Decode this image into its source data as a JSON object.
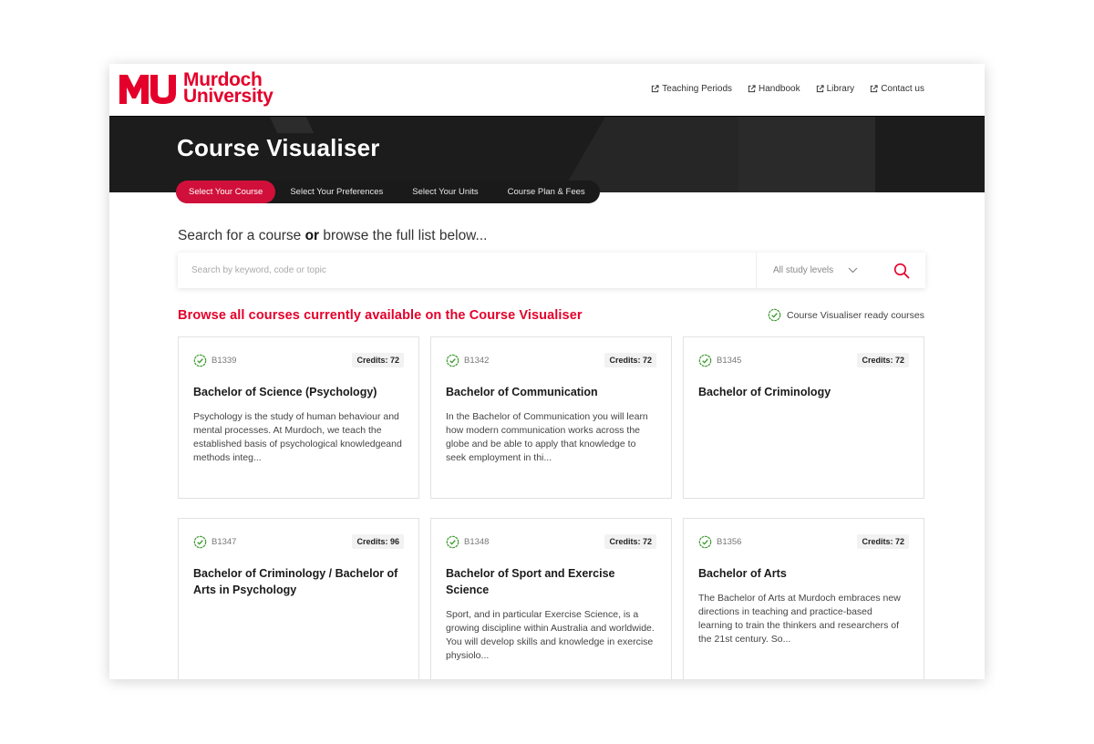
{
  "brand": {
    "logo_line1": "Murdoch",
    "logo_line2": "University",
    "color": "#e4002b"
  },
  "top_links": [
    {
      "label": "Teaching Periods",
      "icon": "external-link-icon"
    },
    {
      "label": "Handbook",
      "icon": "external-link-icon"
    },
    {
      "label": "Library",
      "icon": "external-link-icon"
    },
    {
      "label": "Contact us",
      "icon": "external-link-icon"
    }
  ],
  "hero": {
    "title": "Course Visualiser"
  },
  "steps": [
    {
      "label": "Select Your Course",
      "active": true
    },
    {
      "label": "Select Your Preferences",
      "active": false
    },
    {
      "label": "Select Your Units",
      "active": false
    },
    {
      "label": "Course Plan & Fees",
      "active": false
    }
  ],
  "search": {
    "heading_pre": "Search for a course ",
    "heading_bold": "or",
    "heading_post": " browse the full list below...",
    "placeholder": "Search by keyword, code or topic",
    "value": "",
    "level_selected": "All study levels"
  },
  "browse": {
    "title": "Browse all courses currently available on the Course Visualiser",
    "legend": "Course Visualiser ready courses"
  },
  "courses": [
    {
      "code": "B1339",
      "credits": "Credits: 72",
      "title": "Bachelor of Science (Psychology)",
      "desc": "Psychology is the study of human behaviour and mental processes. At Murdoch, we teach the established basis of psychological knowledgeand methods integ..."
    },
    {
      "code": "B1342",
      "credits": "Credits: 72",
      "title": "Bachelor of Communication",
      "desc": "In the Bachelor of Communication you will learn how modern communication works across the globe and be able to apply that knowledge to seek employment in thi..."
    },
    {
      "code": "B1345",
      "credits": "Credits: 72",
      "title": "Bachelor of Criminology",
      "desc": ""
    },
    {
      "code": "B1347",
      "credits": "Credits: 96",
      "title": "Bachelor of Criminology / Bachelor of Arts in Psychology",
      "desc": ""
    },
    {
      "code": "B1348",
      "credits": "Credits: 72",
      "title": "Bachelor of Sport and Exercise Science",
      "desc": "Sport, and in particular Exercise Science, is a growing discipline within Australia and worldwide. You will develop skills and knowledge in exercise physiolo..."
    },
    {
      "code": "B1356",
      "credits": "Credits: 72",
      "title": "Bachelor of Arts",
      "desc": "The Bachelor of Arts at Murdoch embraces new directions in teaching and practice-based learning to train the thinkers and researchers of the 21st century. So..."
    }
  ]
}
